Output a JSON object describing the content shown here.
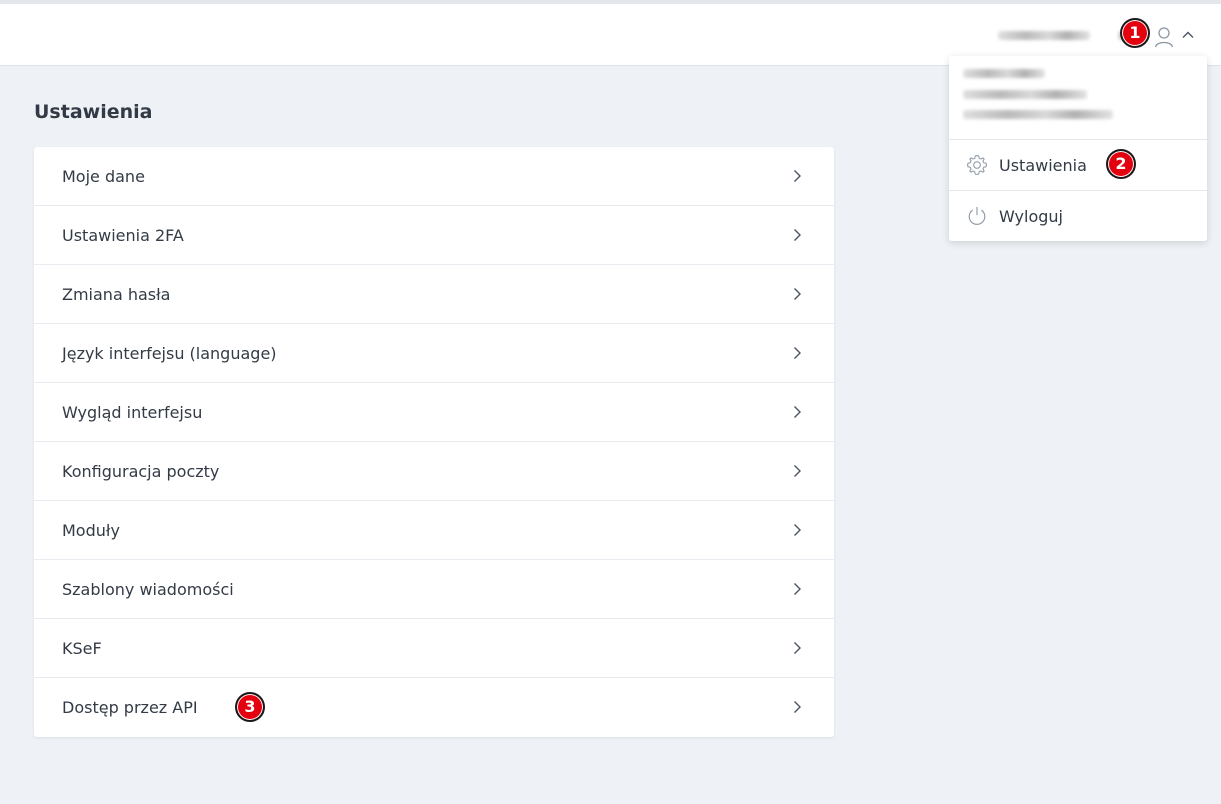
{
  "header": {
    "user_icon": "user-icon",
    "toggle_icon": "chevron-up-icon"
  },
  "page": {
    "title": "Ustawienia"
  },
  "settings_list": [
    {
      "label": "Moje dane",
      "icon": "chevron-right-icon"
    },
    {
      "label": "Ustawienia 2FA",
      "icon": "chevron-right-icon"
    },
    {
      "label": "Zmiana hasła",
      "icon": "chevron-right-icon"
    },
    {
      "label": "Język interfejsu (language)",
      "icon": "chevron-right-icon"
    },
    {
      "label": "Wygląd interfejsu",
      "icon": "chevron-right-icon"
    },
    {
      "label": "Konfiguracja poczty",
      "icon": "chevron-right-icon"
    },
    {
      "label": "Moduły",
      "icon": "chevron-right-icon"
    },
    {
      "label": "Szablony wiadomości",
      "icon": "chevron-right-icon"
    },
    {
      "label": "KSeF",
      "icon": "chevron-right-icon"
    },
    {
      "label": "Dostęp przez API",
      "icon": "chevron-right-icon"
    }
  ],
  "dropdown": {
    "items": [
      {
        "label": "Ustawienia",
        "icon": "gear-icon"
      },
      {
        "label": "Wyloguj",
        "icon": "power-icon"
      }
    ]
  },
  "annotations": {
    "badge_1": "1",
    "badge_2": "2",
    "badge_3": "3",
    "badge_color": "#e3000f"
  },
  "colors": {
    "background": "#eef2f6",
    "card": "#ffffff",
    "text": "#333b46"
  }
}
